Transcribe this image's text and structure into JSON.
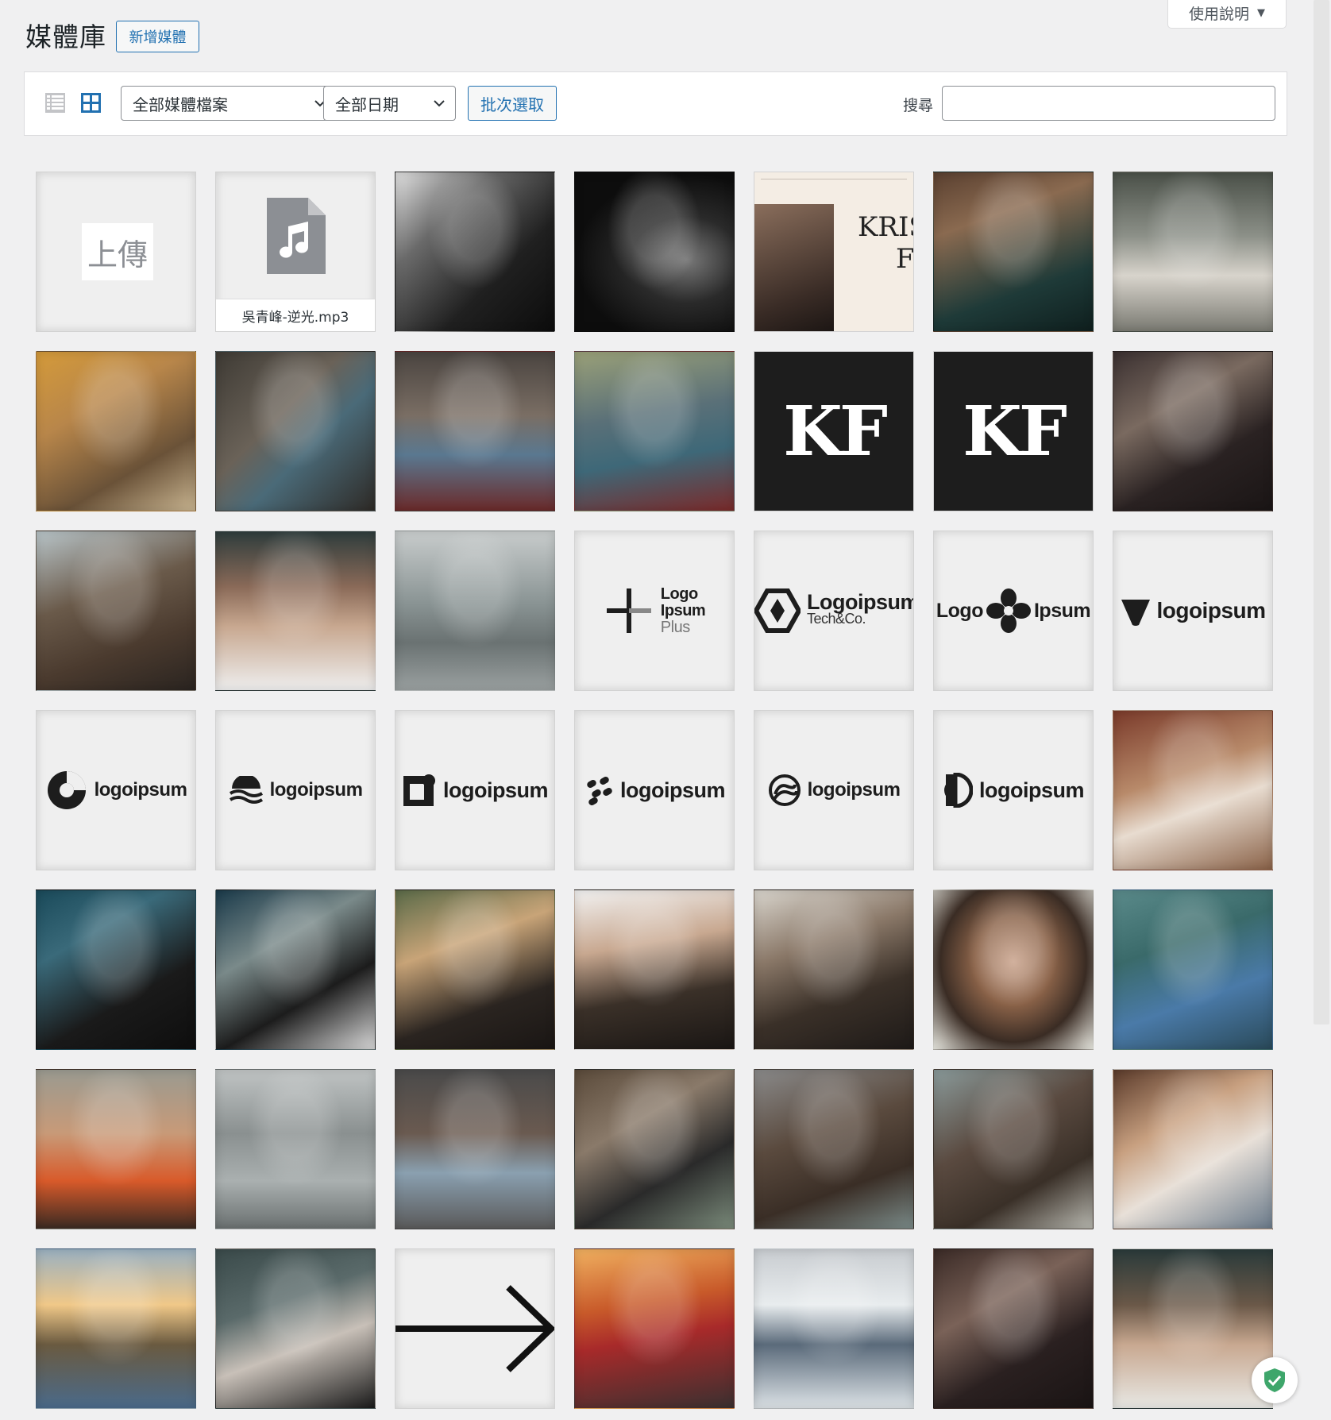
{
  "help_tab": {
    "label": "使用說明"
  },
  "page": {
    "title": "媒體庫",
    "add_new_label": "新增媒體"
  },
  "toolbar": {
    "view_modes": [
      "list-view-icon",
      "grid-view-icon"
    ],
    "active_view": "grid",
    "type_filter": {
      "selected": "全部媒體檔案"
    },
    "date_filter": {
      "selected": "全部日期"
    },
    "bulk_select_label": "批次選取",
    "search_label": "搜尋",
    "search_value": ""
  },
  "upload_tile": {
    "label": "上傳"
  },
  "audio_tile": {
    "filename": "吳青峰-逆光.mp3",
    "icon": "music-note-icon"
  },
  "fashion_tile": {
    "text_line1": "KRIS",
    "text_line2": "Fo"
  },
  "kf_logo": {
    "text": "KF"
  },
  "logos": {
    "logo_plus": {
      "line1": "Logo",
      "line2": "Ipsum",
      "line3": "Plus"
    },
    "logo_tech": {
      "line1": "Logoipsum",
      "line2": "Tech&Co."
    },
    "logo_flower": {
      "left": "Logo",
      "right": "Ipsum"
    },
    "wordmark": "logoipsum"
  },
  "colors": {
    "accent": "#2271b1",
    "background": "#f0f0f1",
    "tile_dark": "#1d1d1d"
  }
}
